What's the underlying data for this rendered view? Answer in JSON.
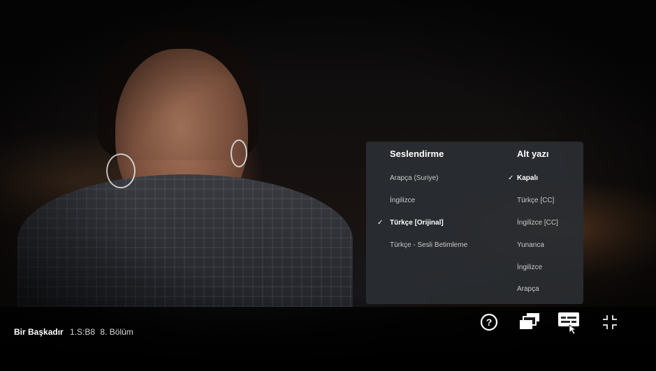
{
  "audio": {
    "heading": "Seslendirme",
    "options": [
      {
        "label": "Arapça (Suriye)",
        "selected": false
      },
      {
        "label": "İngilizce",
        "selected": false
      },
      {
        "label": "Türkçe [Orijinal]",
        "selected": true
      },
      {
        "label": "Türkçe - Sesli Betimleme",
        "selected": false
      }
    ]
  },
  "subtitles": {
    "heading": "Alt yazı",
    "options": [
      {
        "label": "Kapalı",
        "selected": true
      },
      {
        "label": "Türkçe [CC]",
        "selected": false
      },
      {
        "label": "İngilizce [CC]",
        "selected": false
      },
      {
        "label": "Yunanca",
        "selected": false
      },
      {
        "label": "İngilizce",
        "selected": false
      },
      {
        "label": "Arapça",
        "selected": false
      }
    ]
  },
  "now_playing": {
    "show": "Bir Başkadır",
    "episode_code": "1.S:B8",
    "episode_title": "8. Bölüm"
  },
  "controls": [
    "help-icon",
    "episodes-icon",
    "audio-subtitles-icon",
    "exit-fullscreen-icon"
  ],
  "check_mark": "✓",
  "help_glyph": "?"
}
